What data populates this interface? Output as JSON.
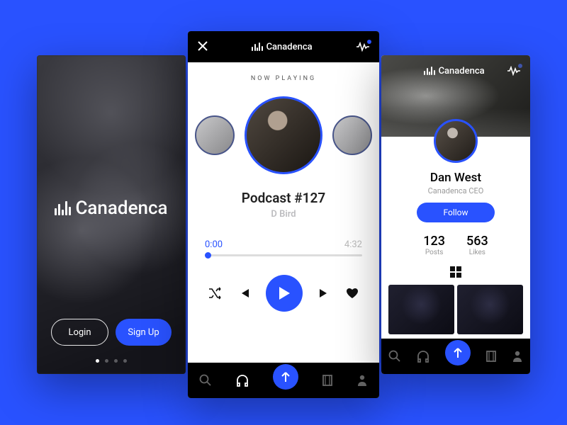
{
  "brand": "Canadenca",
  "splash": {
    "login_label": "Login",
    "signup_label": "Sign Up"
  },
  "player": {
    "now_playing_label": "NOW PLAYING",
    "track_title": "Podcast #127",
    "artist": "D Bird",
    "current_time": "0:00",
    "duration": "4:32"
  },
  "profile": {
    "name": "Dan West",
    "role": "Canadenca CEO",
    "follow_label": "Follow",
    "posts_count": "123",
    "posts_label": "Posts",
    "likes_count": "563",
    "likes_label": "Likes"
  }
}
